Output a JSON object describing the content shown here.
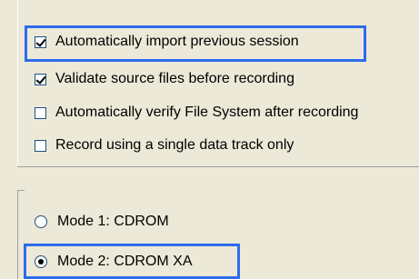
{
  "options_group": {
    "checkboxes": [
      {
        "label": "Automatically import previous session",
        "checked": true
      },
      {
        "label": "Validate source files before recording",
        "checked": true
      },
      {
        "label": "Automatically verify File System after recording",
        "checked": false
      },
      {
        "label": "Record using a single data track only",
        "checked": false
      }
    ]
  },
  "mode_group": {
    "radios": [
      {
        "label": "Mode 1: CDROM",
        "selected": false
      },
      {
        "label": "Mode 2: CDROM XA",
        "selected": true
      }
    ]
  },
  "highlight_color": "#2f6bea"
}
